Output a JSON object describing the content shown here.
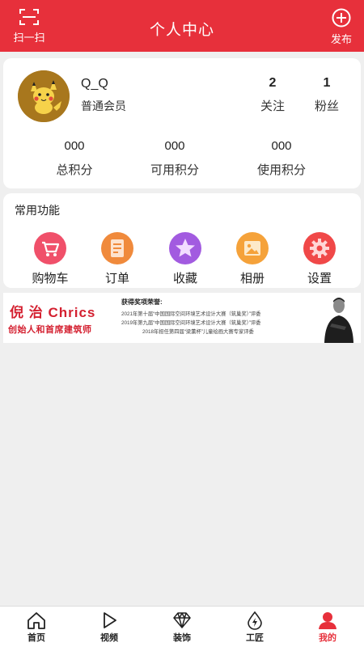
{
  "header": {
    "title": "个人中心",
    "scan_label": "扫一扫",
    "publish_label": "发布"
  },
  "profile": {
    "username": "Q_Q",
    "level": "普通会员",
    "follow": {
      "count": "2",
      "label": "关注"
    },
    "fans": {
      "count": "1",
      "label": "粉丝"
    },
    "points": [
      {
        "value": "000",
        "label": "总积分"
      },
      {
        "value": "000",
        "label": "可用积分"
      },
      {
        "value": "000",
        "label": "使用积分"
      }
    ]
  },
  "functions": {
    "title": "常用功能",
    "items": [
      {
        "label": "购物车",
        "icon": "cart-icon",
        "color": "#f0506a"
      },
      {
        "label": "订单",
        "icon": "order-icon",
        "color": "#f08a3c"
      },
      {
        "label": "收藏",
        "icon": "star-icon",
        "color": "#a25be0"
      },
      {
        "label": "相册",
        "icon": "album-icon",
        "color": "#f5a23a"
      },
      {
        "label": "设置",
        "icon": "gear-icon",
        "color": "#f04848"
      }
    ]
  },
  "banner": {
    "name": "倪 治 Chrics",
    "role": "创始人和首席建筑师",
    "awards_title": "获得奖项荣誉:",
    "awards": [
      "2021年第十届“中国国际空间环境艺术设计大赛（筑巢奖）”评委",
      "2019年第九届“中国国际空间环境艺术设计大赛（筑巢奖）”评委",
      "2018年担任第四届“梁薰杯”儿童绘画大赛专家评委"
    ]
  },
  "tabs": [
    {
      "label": "首页",
      "icon": "home-icon"
    },
    {
      "label": "视频",
      "icon": "play-icon"
    },
    {
      "label": "装饰",
      "icon": "diamond-icon"
    },
    {
      "label": "工匠",
      "icon": "craftsman-icon"
    },
    {
      "label": "我的",
      "icon": "user-icon",
      "active": true
    }
  ],
  "colors": {
    "brand": "#e7303b",
    "banner_text": "#d42030"
  }
}
